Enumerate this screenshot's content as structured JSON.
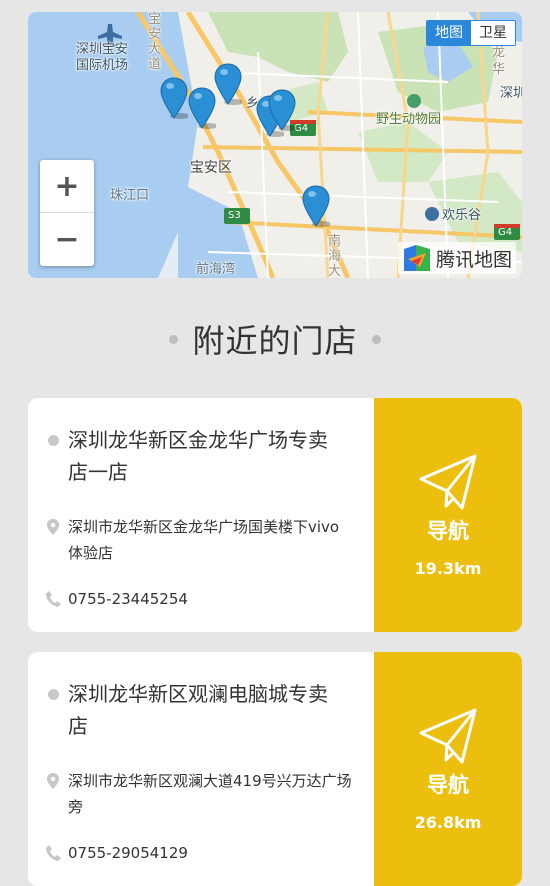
{
  "map": {
    "toggle": {
      "map_label": "地图",
      "satellite_label": "卫星"
    },
    "zoom": {
      "in_label": "+",
      "out_label": "−"
    },
    "labels": {
      "airport": "深圳宝安\n国际机场",
      "baoan": "宝安区",
      "zhujiangkou": "珠江口",
      "qianhaiwan": "前海湾",
      "zoo": "野生动物园",
      "huanlegu": "欢乐谷",
      "longhua": "龙\n华",
      "shen": "深圳",
      "road_bao": "宝\n安\n大\n道",
      "road_nanhai": "南\n海\n大",
      "g4": "G4",
      "s3": "S3",
      "xiang": "乡"
    },
    "logo_text": "腾讯地图"
  },
  "section": {
    "title": "附近的门店"
  },
  "stores": [
    {
      "name": "深圳龙华新区金龙华广场专卖店一店",
      "address": "深圳市龙华新区金龙华广场国美楼下vivo体验店",
      "phone": "0755-23445254",
      "nav_label": "导航",
      "distance": "19.3km"
    },
    {
      "name": "深圳龙华新区观澜电脑城专卖店",
      "address": "深圳市龙华新区观澜大道419号兴万达广场旁",
      "phone": "0755-29054129",
      "nav_label": "导航",
      "distance": "26.8km"
    }
  ],
  "colors": {
    "accent": "#ecbf0f",
    "map_toggle": "#2a87d9",
    "pin": "#2b8fd6"
  },
  "icons": [
    "plus-icon",
    "minus-icon",
    "map-pin-icon",
    "location-icon",
    "phone-icon",
    "paper-plane-icon",
    "tencent-map-logo-icon"
  ]
}
